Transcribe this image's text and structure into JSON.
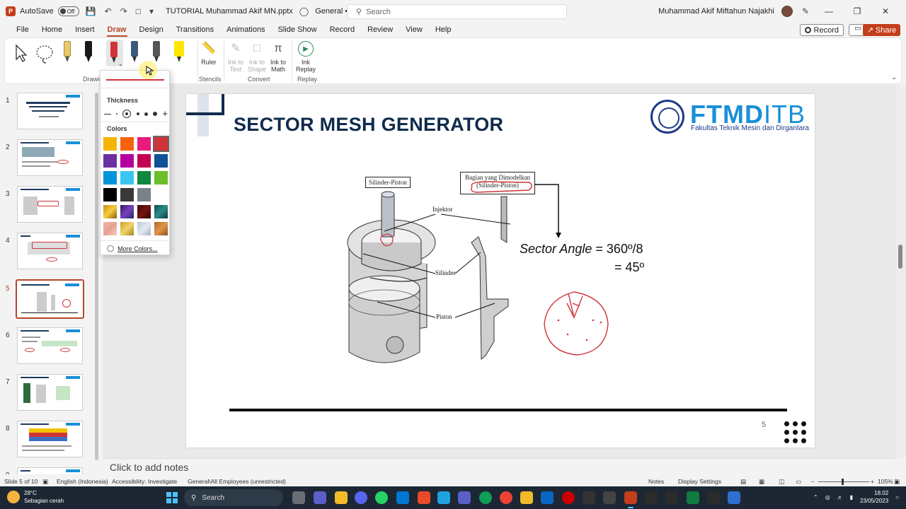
{
  "titlebar": {
    "autosave_label": "AutoSave",
    "autosave_state": "Off",
    "doc_title": "TUTORIAL Muhammad Akif MN.pptx",
    "sensitivity": "General • Saved to this PC",
    "search_placeholder": "Search",
    "user_name": "Muhammad Akif Miftahun Najakhi"
  },
  "menu": {
    "tabs": [
      "File",
      "Home",
      "Insert",
      "Draw",
      "Design",
      "Transitions",
      "Animations",
      "Slide Show",
      "Record",
      "Review",
      "View",
      "Help"
    ],
    "active": "Draw",
    "record_label": "Record",
    "share_label": "Share"
  },
  "ribbon": {
    "drawing_label": "Drawin",
    "stencils_label": "Stencils",
    "convert_label": "Convert",
    "replay_label": "Replay",
    "ruler": "Ruler",
    "ink_to_text": "Ink to Text",
    "ink_to_shape": "Ink to Shape",
    "ink_to_math": "Ink to Math",
    "ink_replay": "Ink Replay",
    "pen_colors": [
      "#1a1a1a",
      "#d13438",
      "#3b5a7a",
      "#555555",
      "#ffe600"
    ],
    "highlighter_color": "#f4e04d"
  },
  "pen_dropdown": {
    "thickness_label": "Thickness",
    "colors_label": "Colors",
    "more_colors": "More Colors...",
    "selected_color": "#d13438",
    "swatches": [
      "#f5b400",
      "#f7630c",
      "#e81c7a",
      "#d13438",
      "#6b2fa0",
      "#b4009e",
      "#c30052",
      "#0f5297",
      "#0095d9",
      "#3ac6f0",
      "#10893e",
      "#6bbe2a",
      "#000000",
      "#393939",
      "#7a8286",
      "",
      "gold-gradient",
      "galaxy",
      "dark-red",
      "teal-texture",
      "rose-gold",
      "gold-glitter",
      "silver",
      "bronze"
    ]
  },
  "thumbnails": {
    "numbers": [
      "1",
      "2",
      "3",
      "4",
      "5",
      "6",
      "7",
      "8",
      "9"
    ],
    "active": 5
  },
  "slide": {
    "title": "SECTOR MESH GENERATOR",
    "logo_main": "FTMD",
    "logo_itb": "ITB",
    "logo_sub": "Fakultas Teknik Mesin dan Dirgantara",
    "label_silinder_piston": "Silinder-Piston",
    "label_bagian": "Bagian yang Dimodelkan",
    "label_bagian2": "(Silinder-Piston)",
    "label_injektor": "Injektor",
    "label_silinder": "Silinder",
    "label_piston": "Piston",
    "sector_angle_it": "Sector Angle",
    "sector_angle_eq": " = 360º/8",
    "sector_angle_result": "= 45º",
    "page_number": "5"
  },
  "notes": {
    "placeholder": "Click to add notes"
  },
  "status": {
    "slide_of": "Slide 5 of 10",
    "language": "English (Indonesia)",
    "accessibility": "Accessibility: Investigate",
    "sensitivity": "General\\All Employees (unrestricted)",
    "notes": "Notes",
    "display_settings": "Display Settings",
    "zoom": "105%"
  },
  "taskbar": {
    "temperature": "28°C",
    "weather": "Sebagian cerah",
    "search": "Search",
    "time": "18.02",
    "date": "23/05/2023"
  }
}
